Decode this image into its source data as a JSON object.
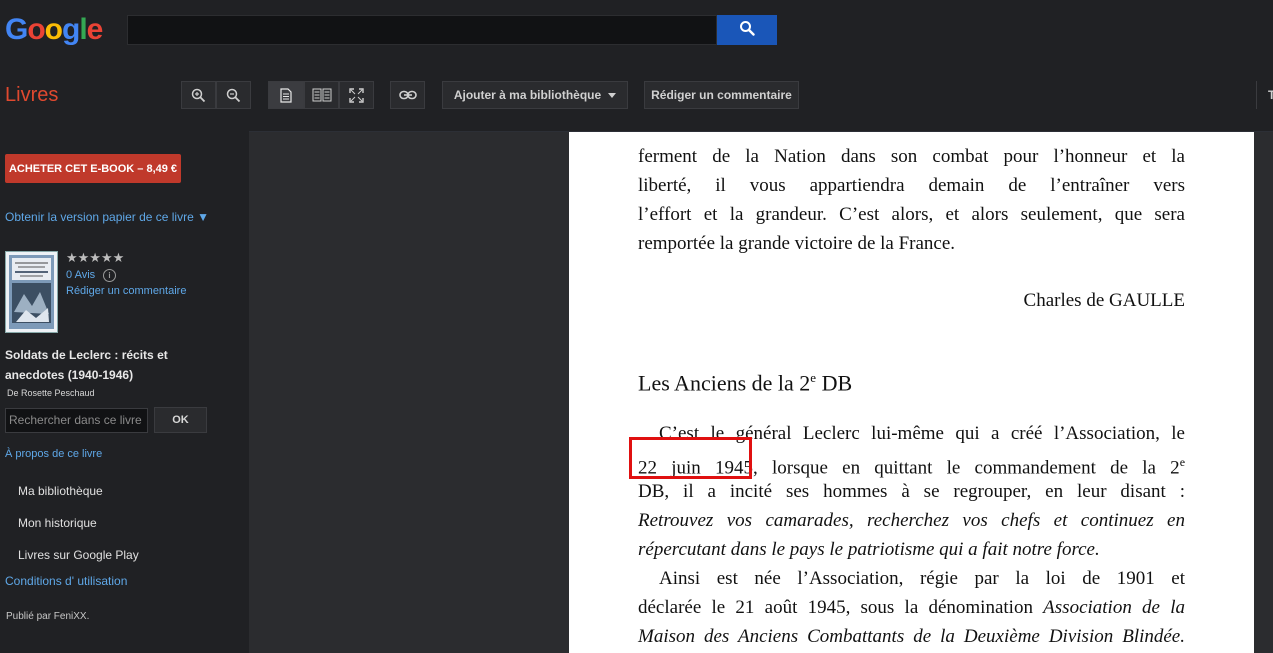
{
  "header": {
    "logo_text": "Google",
    "logo_letters": [
      {
        "ch": "G",
        "color": "#4285f4"
      },
      {
        "ch": "o",
        "color": "#ea4335"
      },
      {
        "ch": "o",
        "color": "#fbbc05"
      },
      {
        "ch": "g",
        "color": "#4285f4"
      },
      {
        "ch": "l",
        "color": "#34a853"
      },
      {
        "ch": "e",
        "color": "#ea4335"
      }
    ],
    "search_value": "",
    "search_icon": "search-icon"
  },
  "toolbar": {
    "brand": "Livres",
    "zoom_in_icon": "zoom-in-icon",
    "zoom_out_icon": "zoom-out-icon",
    "single_page_icon": "single-page-icon",
    "two_page_icon": "two-page-icon",
    "fullscreen_icon": "fullscreen-icon",
    "link_icon": "link-icon",
    "add_library_label": "Ajouter à ma bibliothèque",
    "review_label": "Rédiger un commentaire",
    "right_cut_label": "T"
  },
  "sidebar": {
    "buy_label": "ACHETER CET E-BOOK – 8,49 €",
    "paper_link": "Obtenir la version papier de ce livre ▼",
    "stars": "★★★★★",
    "reviews_count": "0 Avis",
    "info_icon": "i",
    "write_review": "Rédiger un commentaire",
    "book_title": "Soldats de Leclerc : récits et anecdotes (1940-1946)",
    "author": "De Rosette Peschaud",
    "book_search_placeholder": "Rechercher dans ce livre",
    "ok_label": "OK",
    "about_link": "À propos de ce livre",
    "nav_items": [
      "Ma bibliothèque",
      "Mon historique",
      "Livres sur Google Play"
    ],
    "terms_link": "Conditions d' utilisation",
    "publisher": "Publié par FeniXX."
  },
  "page": {
    "para1_lines": [
      "ferment de la Nation dans son combat pour l’honneur et la",
      "liberté, il vous appartiendra demain de l’entraîner vers",
      "l’effort et la grandeur. C’est alors, et alors seulement, que sera",
      "remportée la grande victoire de la France."
    ],
    "signature": "Charles de GAULLE",
    "heading_main": "Les Anciens de la 2",
    "heading_sup": "e",
    "heading_tail": " DB",
    "para2_line1": "C’est le général Leclerc lui-même qui a créé l’Association, le",
    "para2_line2_date": "22 juin 1945",
    "para2_line2_rest": ", lorsque en quittant le commandement de la 2",
    "para2_line2_sup": "e",
    "para2_line3": "DB, il a incité ses hommes à se regrouper, en leur disant :",
    "para2_line4": "Retrouvez vos camarades, recherchez vos chefs et continuez en",
    "para2_line5": "répercutant dans le pays le patriotisme qui a fait notre force.",
    "para3_line1": "Ainsi est née l’Association, régie par la loi de 1901 et",
    "para3_line2_plain": "déclarée le 21 août 1945, sous la dénomination ",
    "para3_line2_italic": "Association de la",
    "para3_line3": "Maison des Anciens Combattants de la Deuxième Division Blindée."
  }
}
